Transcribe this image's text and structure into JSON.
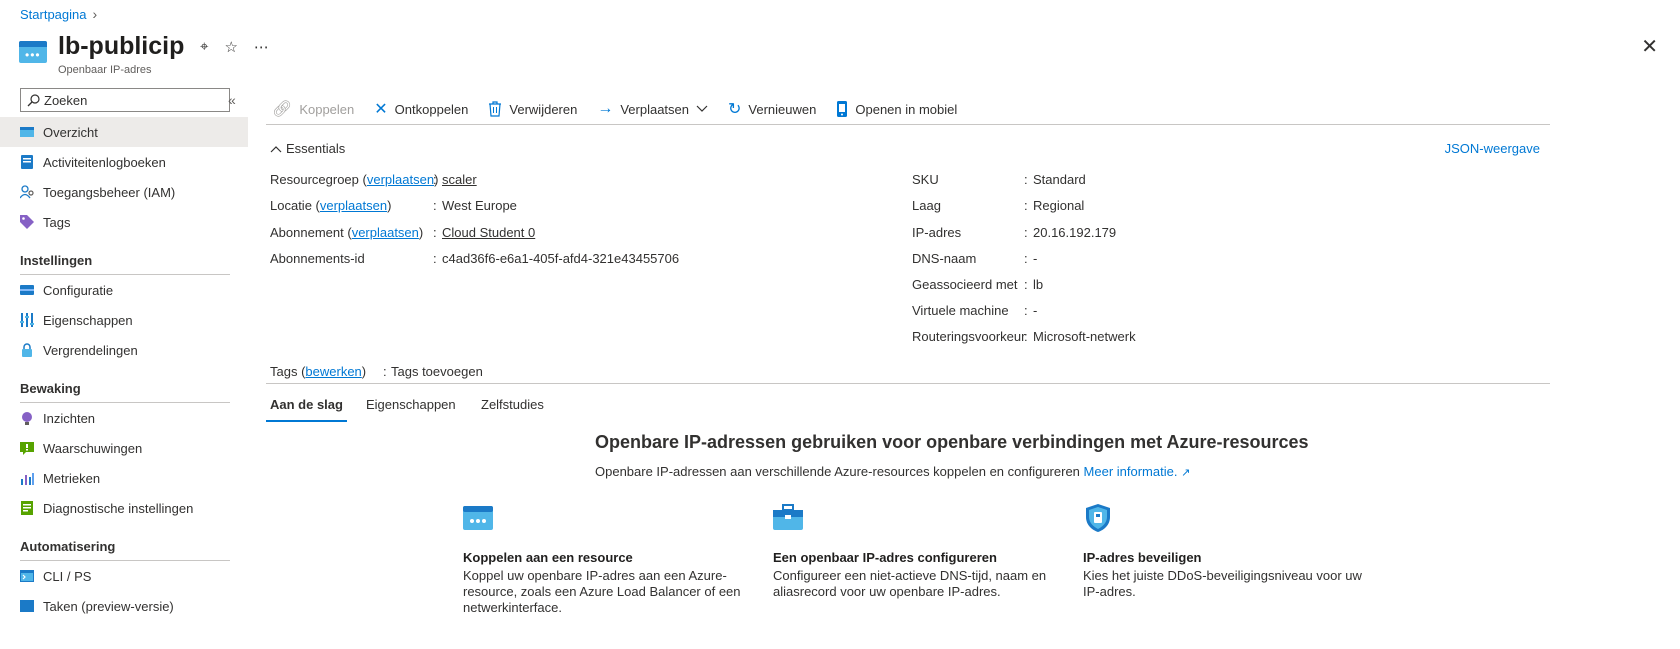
{
  "breadcrumb": {
    "home": "Startpagina",
    "sep": "›"
  },
  "resource": {
    "title": "lb-publicip",
    "subtitle": "Openbaar IP-adres"
  },
  "header_actions": {
    "pin": "⌖",
    "star": "☆",
    "more": "⋯",
    "close": "✕"
  },
  "sidebar": {
    "search_placeholder": "Zoeken",
    "collapse": "«",
    "items": [
      {
        "label": "Overzicht",
        "icon": "overview-icon",
        "active": true
      },
      {
        "label": "Activiteitenlogboeken",
        "icon": "activity-log-icon"
      },
      {
        "label": "Toegangsbeheer (IAM)",
        "icon": "iam-icon"
      },
      {
        "label": "Tags",
        "icon": "tag-icon"
      }
    ],
    "sections": [
      {
        "title": "Instellingen",
        "items": [
          {
            "label": "Configuratie",
            "icon": "configuration-icon"
          },
          {
            "label": "Eigenschappen",
            "icon": "properties-icon"
          },
          {
            "label": "Vergrendelingen",
            "icon": "lock-icon"
          }
        ]
      },
      {
        "title": "Bewaking",
        "items": [
          {
            "label": "Inzichten",
            "icon": "insights-icon"
          },
          {
            "label": "Waarschuwingen",
            "icon": "alerts-icon"
          },
          {
            "label": "Metrieken",
            "icon": "metrics-icon"
          },
          {
            "label": "Diagnostische instellingen",
            "icon": "diagnostics-icon"
          }
        ]
      },
      {
        "title": "Automatisering",
        "items": [
          {
            "label": "CLI / PS",
            "icon": "cli-icon"
          },
          {
            "label": "Taken (preview-versie)",
            "icon": "tasks-icon"
          }
        ]
      }
    ]
  },
  "toolbar": {
    "koppelen": "Koppelen",
    "ontkoppelen": "Ontkoppelen",
    "verwijderen": "Verwijderen",
    "verplaatsen": "Verplaatsen",
    "vernieuwen": "Vernieuwen",
    "mobiel": "Openen in mobiel"
  },
  "essentials": {
    "toggle": "Essentials",
    "json_view": "JSON-weergave",
    "left": {
      "resourcegroep": {
        "label": "Resourcegroep",
        "link": "verplaatsen",
        "value": "scaler"
      },
      "locatie": {
        "label": "Locatie",
        "link": "verplaatsen",
        "value": "West Europe"
      },
      "abonnement": {
        "label": "Abonnement",
        "link": "verplaatsen",
        "value": "Cloud Student 0"
      },
      "abonnements_id": {
        "label": "Abonnements-id",
        "value": "c4ad36f6-e6a1-405f-afd4-321e43455706"
      }
    },
    "right": {
      "sku": {
        "label": "SKU",
        "value": "Standard"
      },
      "laag": {
        "label": "Laag",
        "value": "Regional"
      },
      "ip": {
        "label": "IP-adres",
        "value": "20.16.192.179"
      },
      "dns": {
        "label": "DNS-naam",
        "value": "-"
      },
      "assoc": {
        "label": "Geassocieerd met",
        "value": "lb"
      },
      "vm": {
        "label": "Virtuele machine",
        "value": "-"
      },
      "routing": {
        "label": "Routeringsvoorkeur",
        "value": "Microsoft-netwerk"
      }
    },
    "tags": {
      "label": "Tags",
      "link": "bewerken",
      "value": "Tags toevoegen"
    }
  },
  "tabs": [
    "Aan de slag",
    "Eigenschappen",
    "Zelfstudies"
  ],
  "getting_started": {
    "title": "Openbare IP-adressen gebruiken voor openbare verbindingen met Azure-resources",
    "subtitle": "Openbare IP-adressen aan verschillende Azure-resources koppelen en configureren",
    "more_info": "Meer informatie.",
    "cards": [
      {
        "title": "Koppelen aan een resource",
        "text": "Koppel uw openbare IP-adres aan een Azure-resource, zoals een Azure Load Balancer of een netwerkinterface."
      },
      {
        "title": "Een openbaar IP-adres configureren",
        "text": "Configureer een niet-actieve DNS-tijd, naam en aliasrecord voor uw openbare IP-adres."
      },
      {
        "title": "IP-adres beveiligen",
        "text": "Kies het juiste DDoS-beveiligingsniveau voor uw IP-adres."
      }
    ]
  },
  "colors": {
    "accent": "#0078d4",
    "active_bg": "#edebe9",
    "text": "#323130"
  }
}
